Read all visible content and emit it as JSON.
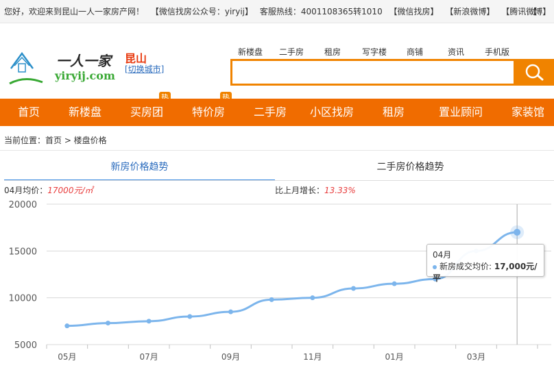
{
  "topbar": {
    "welcome": "您好，欢迎来到昆山一人一家房产网！",
    "wechat_account": "【微信找房公众号：yiryij】",
    "hotline": "客服热线：4001108365转1010",
    "wechat": "【微信找房】",
    "sina": "【新浪微博】",
    "tencent": "【腾讯微博】",
    "cut": "【"
  },
  "header": {
    "logo_cn": "一人一家",
    "logo_en": "yiryij.com",
    "city": "昆山",
    "switch_city": "[切换城市]"
  },
  "quicklinks": [
    "新楼盘",
    "二手房",
    "租房",
    "写字楼",
    "商铺",
    "资讯",
    "手机版"
  ],
  "search": {
    "placeholder": "",
    "value": ""
  },
  "mainnav": {
    "items": [
      "首页",
      "新楼盘",
      "买房团",
      "特价房",
      "二手房",
      "小区找房",
      "租房",
      "置业顾问",
      "家装馆"
    ],
    "hot_badge": "热"
  },
  "breadcrumb": "当前位置：首页 > 楼盘价格",
  "tabs": [
    "新房价格趋势",
    "二手房价格趋势"
  ],
  "stats": {
    "avg_label": "04月均价：",
    "avg_value": "17000元/㎡",
    "growth_label": "比上月增长：",
    "growth_value": "13.33%"
  },
  "tooltip": {
    "month": "04月",
    "series_label": "新房成交均价: ",
    "value": "17,000元/平"
  },
  "colors": {
    "orange": "#f06c00",
    "line": "#7cb5ec",
    "accent_red": "#e83d3d"
  },
  "chart_data": {
    "type": "line",
    "x": [
      "05月",
      "06月",
      "07月",
      "08月",
      "09月",
      "10月",
      "11月",
      "12月",
      "01月",
      "02月",
      "03月",
      "04月"
    ],
    "x_tick_labels": [
      "05月",
      "07月",
      "09月",
      "11月",
      "01月",
      "03月"
    ],
    "series": [
      {
        "name": "新房成交均价",
        "values": [
          7000,
          7300,
          7500,
          8000,
          8500,
          9800,
          10000,
          11000,
          11500,
          12000,
          15000,
          17000
        ]
      }
    ],
    "ylim": [
      5000,
      20000
    ],
    "yticks": [
      5000,
      10000,
      15000,
      20000
    ],
    "grid": true
  }
}
